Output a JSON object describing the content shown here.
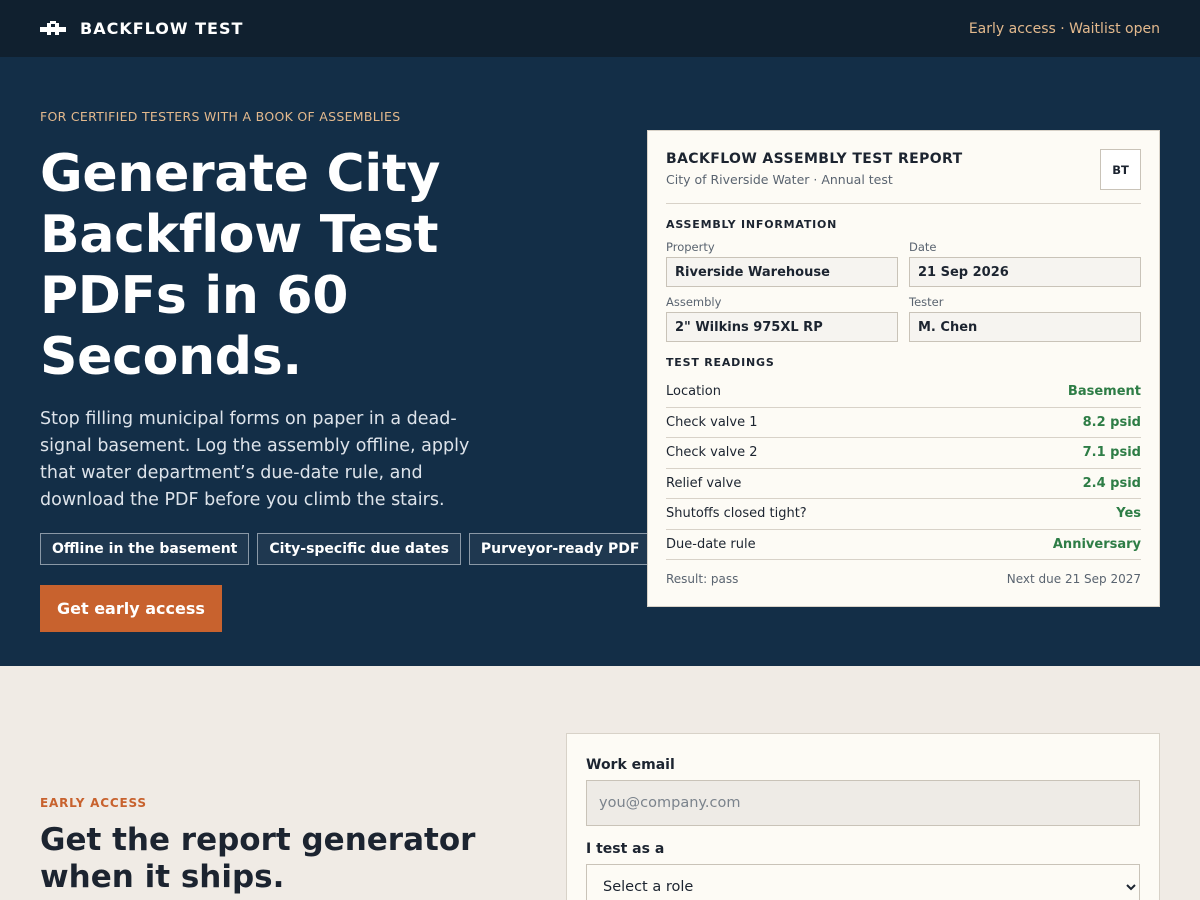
{
  "header": {
    "brand": "BACKFLOW TEST",
    "status": "Early access · Waitlist open"
  },
  "hero": {
    "eyebrow": "FOR CERTIFIED TESTERS WITH A BOOK OF ASSEMBLIES",
    "headline": "Generate City Backflow Test PDFs in 60 Seconds.",
    "lead": "Stop filling municipal forms on paper in a dead-signal basement. Log the assembly offline, apply that water department’s due-date rule, and download the PDF before you climb the stairs.",
    "tags": [
      "Offline in the basement",
      "City-specific due dates",
      "Purveyor-ready PDF"
    ],
    "cta": "Get early access"
  },
  "report": {
    "title": "BACKFLOW ASSEMBLY TEST REPORT",
    "subtitle": "City of Riverside Water · Annual test",
    "badge": "BT",
    "assembly_label": "ASSEMBLY INFORMATION",
    "fields": [
      {
        "label": "Property",
        "value": "Riverside Warehouse"
      },
      {
        "label": "Date",
        "value": "21 Sep 2026"
      },
      {
        "label": "Assembly",
        "value": "2\" Wilkins 975XL RP"
      },
      {
        "label": "Tester",
        "value": "M. Chen"
      }
    ],
    "readings_label": "TEST READINGS",
    "readings": [
      {
        "name": "Location",
        "value": "Basement"
      },
      {
        "name": "Check valve 1",
        "value": "8.2 psid"
      },
      {
        "name": "Check valve 2",
        "value": "7.1 psid"
      },
      {
        "name": "Relief valve",
        "value": "2.4 psid"
      },
      {
        "name": "Shutoffs closed tight?",
        "value": "Yes"
      },
      {
        "name": "Due-date rule",
        "value": "Anniversary"
      }
    ],
    "result": "Result: pass",
    "next_due": "Next due 21 Sep 2027"
  },
  "signup": {
    "eyebrow": "EARLY ACCESS",
    "title": "Get the report generator when it ships.",
    "email_label": "Work email",
    "email_placeholder": "you@company.com",
    "role_label": "I test as a",
    "role_selected": "Select a role"
  },
  "colors": {
    "topbar": "#10202f",
    "hero_bg": "#132e47",
    "accent": "#c8622e",
    "eyebrow": "#e3b98d",
    "reading_value": "#2e7d46",
    "page_bg": "#f0ebe5"
  },
  "icons": {
    "brand": "valve-icon"
  }
}
